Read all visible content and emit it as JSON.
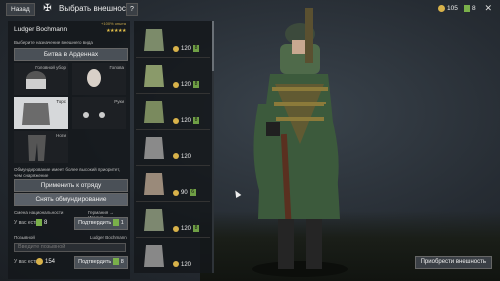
{
  "topbar": {
    "back_label": "Назад",
    "title": "Выбрать внешность",
    "help_label": "?",
    "coins": "105",
    "tickets": "8",
    "close_glyph": "✕"
  },
  "soldier": {
    "exp_label": "+100% опыта",
    "name": "Ludger Bochmann",
    "stars": "★★★★★"
  },
  "left": {
    "preset_label": "Выберите назначение внешнего вида",
    "campaign_button": "Битва в Арденнах",
    "slots": [
      {
        "label": "Головной убор"
      },
      {
        "label": "Голова"
      },
      {
        "label": "Торс"
      },
      {
        "label": "Руки"
      },
      {
        "label": "Ноги"
      }
    ],
    "note": "Обмундирование имеет более высокий приоритет, чем снаряжение",
    "apply_button": "Применить к отряду",
    "remove_button": "Снять обмундирование",
    "nationality_label": "Смена национальности",
    "nationality_value": "Германия → Италия",
    "have_label": "У вас есть:",
    "have_tickets": "8",
    "confirm_label": "Подтвердить",
    "confirm_count": "1",
    "nickname_label": "Позывной",
    "nickname_value": "Ludger Bochmann",
    "nickname_placeholder": "Введите позывной",
    "have_coins": "154",
    "confirm2_count": "8"
  },
  "catalog": {
    "items": [
      {
        "price": "120",
        "ticket": "8"
      },
      {
        "price": "120",
        "ticket": "8"
      },
      {
        "price": "120",
        "ticket": "8"
      },
      {
        "price": "120",
        "ticket": ""
      },
      {
        "price": "90",
        "ticket": "6"
      },
      {
        "price": "120",
        "ticket": "8"
      },
      {
        "price": "120",
        "ticket": ""
      }
    ]
  },
  "buy_button": "Приобрести внешность",
  "colors": {
    "coin": "#d8b24a",
    "ticket": "#7ab04a",
    "panel": "#14171b"
  },
  "icons": {
    "emblem": "iron-cross-icon",
    "close": "close-icon"
  }
}
